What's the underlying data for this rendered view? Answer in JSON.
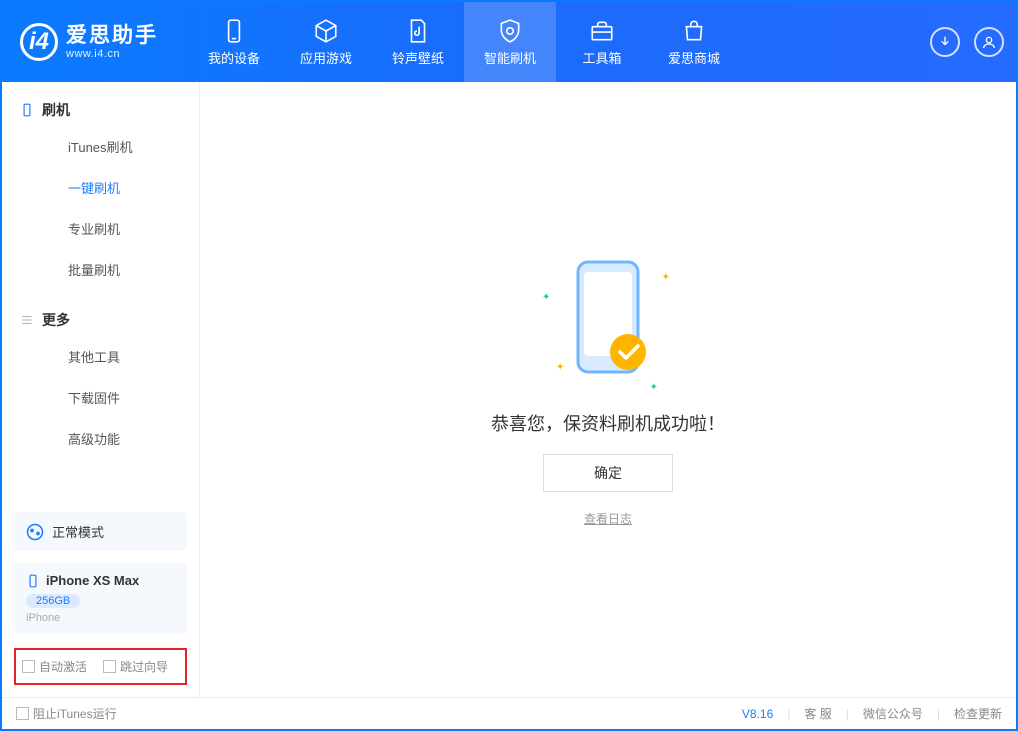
{
  "app": {
    "name": "爱思助手",
    "url": "www.i4.cn"
  },
  "nav": {
    "my_device": "我的设备",
    "apps_games": "应用游戏",
    "ringtone_wallpaper": "铃声壁纸",
    "smart_flash": "智能刷机",
    "toolbox": "工具箱",
    "store": "爱思商城"
  },
  "sidebar": {
    "flash": {
      "title": "刷机",
      "items": {
        "itunes": "iTunes刷机",
        "one_click": "一键刷机",
        "pro": "专业刷机",
        "batch": "批量刷机"
      }
    },
    "more": {
      "title": "更多",
      "items": {
        "other_tools": "其他工具",
        "download_fw": "下载固件",
        "advanced": "高级功能"
      }
    },
    "mode": "正常模式",
    "device": {
      "name": "iPhone XS Max",
      "storage": "256GB",
      "type": "iPhone"
    },
    "options": {
      "auto_activate": "自动激活",
      "skip_guide": "跳过向导"
    }
  },
  "main": {
    "success_message": "恭喜您，保资料刷机成功啦！",
    "ok_button": "确定",
    "view_log": "查看日志"
  },
  "footer": {
    "block_itunes": "阻止iTunes运行",
    "version": "V8.16",
    "support": "客 服",
    "wechat": "微信公众号",
    "check_update": "检查更新"
  }
}
